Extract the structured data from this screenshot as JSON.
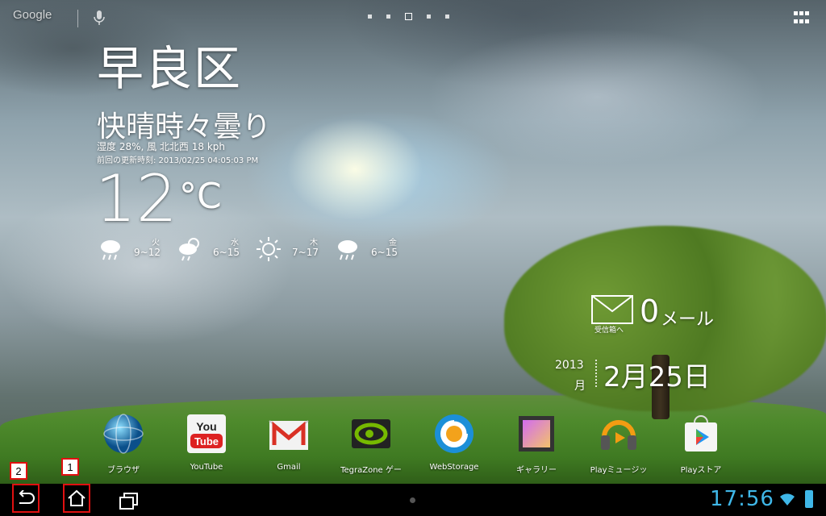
{
  "top_bar": {
    "google_search_label": "Google",
    "page_count": 5,
    "current_page": 3
  },
  "weather": {
    "location": "早良区",
    "condition": "快晴時々曇り",
    "humidity_wind": "湿度 28%, 風 北北西 18 kph",
    "last_updated": "前回の更新時刻: 2013/02/25 04:05:03 PM",
    "temperature": "12",
    "unit": "°C",
    "forecast": [
      {
        "day": "火",
        "range": "9~12",
        "icon": "rain-cloud-icon"
      },
      {
        "day": "水",
        "range": "6~15",
        "icon": "sun-cloud-rain-icon"
      },
      {
        "day": "木",
        "range": "7~17",
        "icon": "sun-icon"
      },
      {
        "day": "金",
        "range": "6~15",
        "icon": "rain-cloud-icon"
      }
    ]
  },
  "mail": {
    "count": "0",
    "label": "メール",
    "inbox_label": "受信箱へ"
  },
  "date": {
    "year": "2013",
    "month_small": "月",
    "date_main": "2月25日"
  },
  "dock": [
    {
      "label": "ブラウザ",
      "icon": "browser-icon"
    },
    {
      "label": "YouTube",
      "icon": "youtube-icon"
    },
    {
      "label": "Gmail",
      "icon": "gmail-icon"
    },
    {
      "label": "TegraZone ゲー",
      "icon": "tegrazone-icon"
    },
    {
      "label": "WebStorage",
      "icon": "webstorage-icon"
    },
    {
      "label": "ギャラリー",
      "icon": "gallery-icon"
    },
    {
      "label": "Playミュージッ",
      "icon": "play-music-icon"
    },
    {
      "label": "Playストア",
      "icon": "play-store-icon"
    }
  ],
  "icon_text": {
    "youtube_you": "You",
    "youtube_tube": "Tube"
  },
  "nav": {
    "back_badge": "2",
    "home_badge": "1",
    "clock": "17:56"
  },
  "colors": {
    "accent": "#3fb7e8",
    "highlight": "#e01010"
  }
}
